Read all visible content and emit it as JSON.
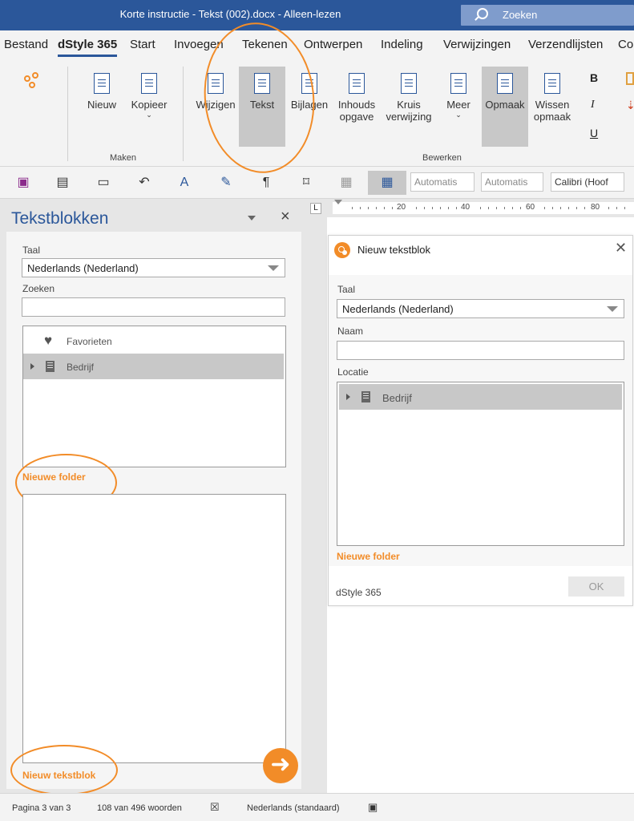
{
  "window": {
    "title": "Korte instructie - Tekst (002).docx  -  Alleen-lezen",
    "search_label": "Zoeken"
  },
  "menu": {
    "tabs": [
      "Bestand",
      "dStyle 365",
      "Start",
      "Invoegen",
      "Tekenen",
      "Ontwerpen",
      "Indeling",
      "Verwijzingen",
      "Verzendlijsten",
      "Co"
    ],
    "active": "dStyle 365"
  },
  "ribbon": {
    "maken": {
      "label": "Maken",
      "buttons": [
        "Nieuw",
        "Kopieer"
      ]
    },
    "bewerken": {
      "label": "Bewerken",
      "buttons": [
        {
          "line1": "Wijzigen",
          "line2": ""
        },
        {
          "line1": "Tekst",
          "line2": ""
        },
        {
          "line1": "Bijlagen",
          "line2": ""
        },
        {
          "line1": "Inhouds",
          "line2": "opgave"
        },
        {
          "line1": "Kruis",
          "line2": "verwijzing"
        },
        {
          "line1": "Meer",
          "line2": ""
        },
        {
          "line1": "Opmaak",
          "line2": ""
        },
        {
          "line1": "Wissen",
          "line2": "opmaak"
        }
      ]
    },
    "format_letters": [
      "B",
      "I",
      "U"
    ]
  },
  "quick_toolbar": {
    "combo1": "Automatis",
    "combo2": "Automatis",
    "font": "Calibri (Hoof"
  },
  "ruler": {
    "marks": [
      "20",
      "40",
      "60",
      "80"
    ],
    "tab_symbol": "L"
  },
  "pane": {
    "title": "Tekstblokken",
    "taal_label": "Taal",
    "taal_value": "Nederlands (Nederland)",
    "zoeken_label": "Zoeken",
    "zoeken_value": "",
    "tree": [
      "Favorieten",
      "Bedrijf"
    ],
    "new_folder": "Nieuwe folder",
    "new_block": "Nieuw tekstblok"
  },
  "dialog": {
    "title": "Nieuw tekstblok",
    "taal_label": "Taal",
    "taal_value": "Nederlands (Nederland)",
    "naam_label": "Naam",
    "naam_value": "",
    "locatie_label": "Locatie",
    "tree": [
      "Bedrijf"
    ],
    "new_folder": "Nieuwe folder",
    "brand": "dStyle 365",
    "ok_label": "OK"
  },
  "status": {
    "page": "Pagina 3 van 3",
    "words": "108 van 496 woorden",
    "language": "Nederlands (standaard)"
  },
  "colors": {
    "brand_blue": "#2b579a",
    "accent_orange": "#f28c28"
  }
}
